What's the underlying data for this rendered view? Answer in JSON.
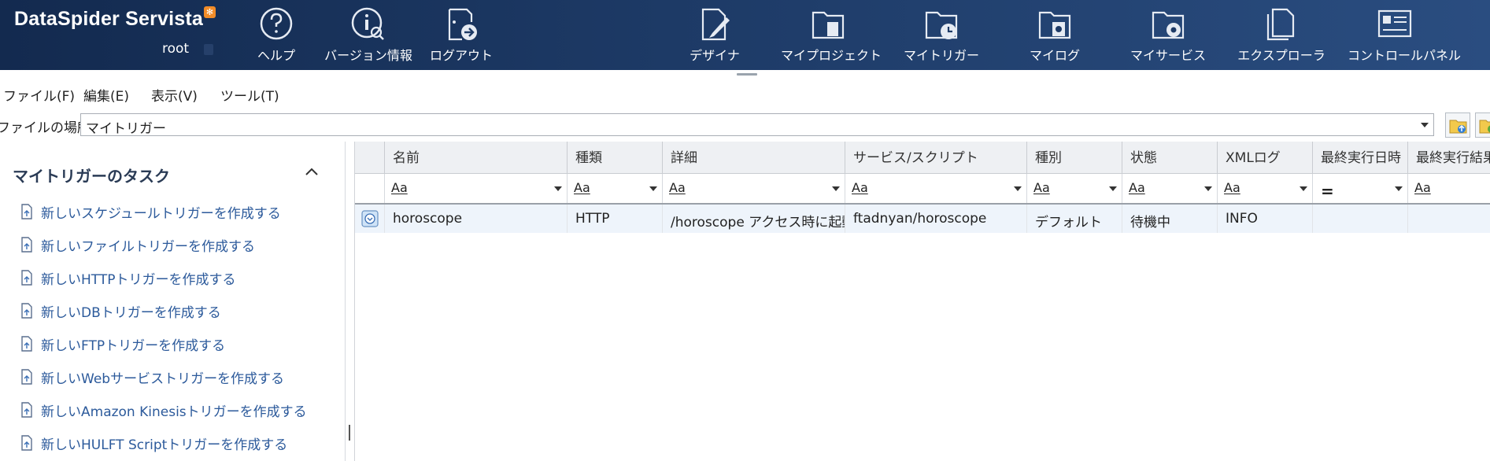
{
  "app": {
    "brand": "DataSpider Servista",
    "user": "root"
  },
  "header": {
    "left_buttons": [
      {
        "label": "ヘルプ",
        "icon": "help-icon"
      },
      {
        "label": "バージョン情報",
        "icon": "version-info-icon"
      },
      {
        "label": "ログアウト",
        "icon": "logout-icon"
      }
    ],
    "right_buttons": [
      {
        "label": "デザイナ",
        "icon": "designer-icon"
      },
      {
        "label": "マイプロジェクト",
        "icon": "my-project-icon"
      },
      {
        "label": "マイトリガー",
        "icon": "my-trigger-icon"
      },
      {
        "label": "マイログ",
        "icon": "my-log-icon"
      },
      {
        "label": "マイサービス",
        "icon": "my-service-icon"
      },
      {
        "label": "エクスプローラ",
        "icon": "explorer-icon"
      },
      {
        "label": "コントロールパネル",
        "icon": "control-panel-icon"
      }
    ]
  },
  "menu": {
    "items": [
      "ファイル(F)",
      "編集(E)",
      "表示(V)",
      "ツール(T)"
    ]
  },
  "location": {
    "label": "ファイルの場所",
    "value": "マイトリガー"
  },
  "tasks": {
    "title": "マイトリガーのタスク",
    "items": [
      "新しいスケジュールトリガーを作成する",
      "新しいファイルトリガーを作成する",
      "新しいHTTPトリガーを作成する",
      "新しいDBトリガーを作成する",
      "新しいFTPトリガーを作成する",
      "新しいWebサービストリガーを作成する",
      "新しいAmazon Kinesisトリガーを作成する",
      "新しいHULFT Scriptトリガーを作成する"
    ]
  },
  "grid": {
    "columns": [
      "名前",
      "種類",
      "詳細",
      "サービス/スクリプト",
      "種別",
      "状態",
      "XMLログ",
      "最終実行日時",
      "最終実行結果"
    ],
    "filter_text": "Aa",
    "filter_equals": "=",
    "rows": [
      {
        "name": "horoscope",
        "type": "HTTP",
        "detail": "/horoscope アクセス時に起動",
        "service": "ftadnyan/horoscope",
        "kind": "デフォルト",
        "state": "待機中",
        "xml_log": "INFO",
        "last_run": "",
        "last_result": ""
      }
    ]
  },
  "colors": {
    "header_dark": "#132a4f",
    "header_light": "#2a4d80",
    "task_link": "#2c5a9b",
    "badge": "#f28c28",
    "row_highlight": "#eef4fb"
  }
}
